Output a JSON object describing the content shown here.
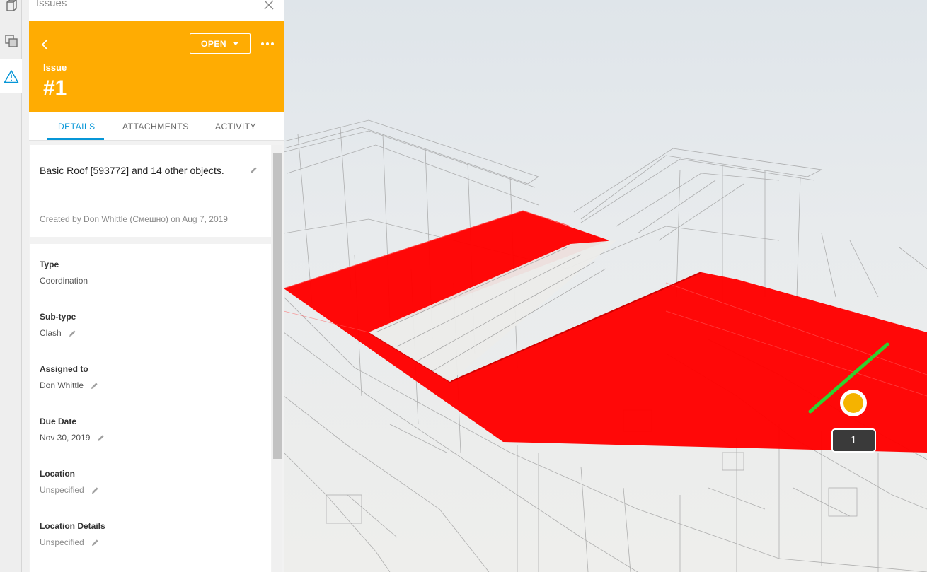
{
  "panel": {
    "title": "Issues"
  },
  "issue": {
    "status": "OPEN",
    "type_label": "Issue",
    "number": "#1",
    "header_color": "#ffac02"
  },
  "tabs": [
    {
      "label": "DETAILS",
      "active": true
    },
    {
      "label": "ATTACHMENTS",
      "active": false
    },
    {
      "label": "ACTIVITY",
      "active": false
    }
  ],
  "summary": {
    "title": "Basic Roof [593772] and 14 other objects.",
    "created": "Created by Don Whittle (Смешно) on Aug 7, 2019"
  },
  "fields": [
    {
      "label": "Type",
      "value": "Coordination",
      "editable": false
    },
    {
      "label": "Sub-type",
      "value": "Clash",
      "editable": true
    },
    {
      "label": "Assigned to",
      "value": "Don Whittle",
      "editable": true
    },
    {
      "label": "Due Date",
      "value": "Nov 30, 2019",
      "editable": true
    },
    {
      "label": "Location",
      "value": "Unspecified",
      "editable": true
    },
    {
      "label": "Location Details",
      "value": "Unspecified",
      "editable": true
    }
  ],
  "viewport": {
    "pushpin_label": "1",
    "clash_color": "#ff0000",
    "pushpin_color": "#f5b300"
  },
  "accent_color": "#0696d7"
}
